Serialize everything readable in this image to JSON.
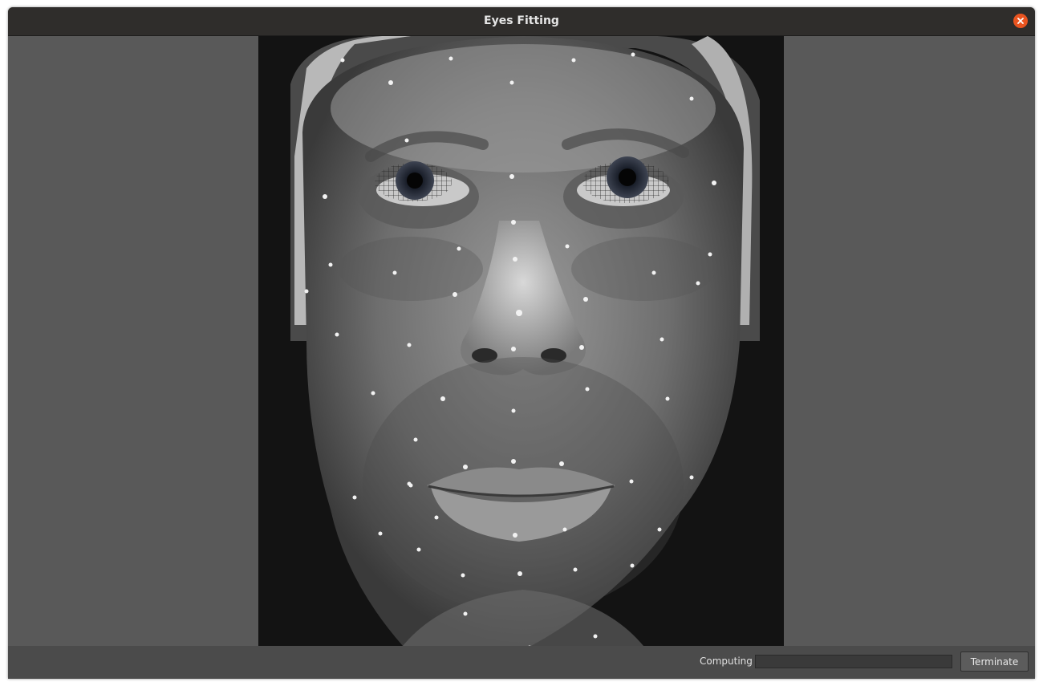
{
  "window": {
    "title": "Eyes Fitting",
    "close_icon": "close-icon",
    "accent_color": "#e95420"
  },
  "viewer": {
    "image_icon": "face-photo-with-eye-mesh-overlay"
  },
  "status": {
    "label": "Computing",
    "progress_percent": 0
  },
  "actions": {
    "terminate_label": "Terminate"
  }
}
